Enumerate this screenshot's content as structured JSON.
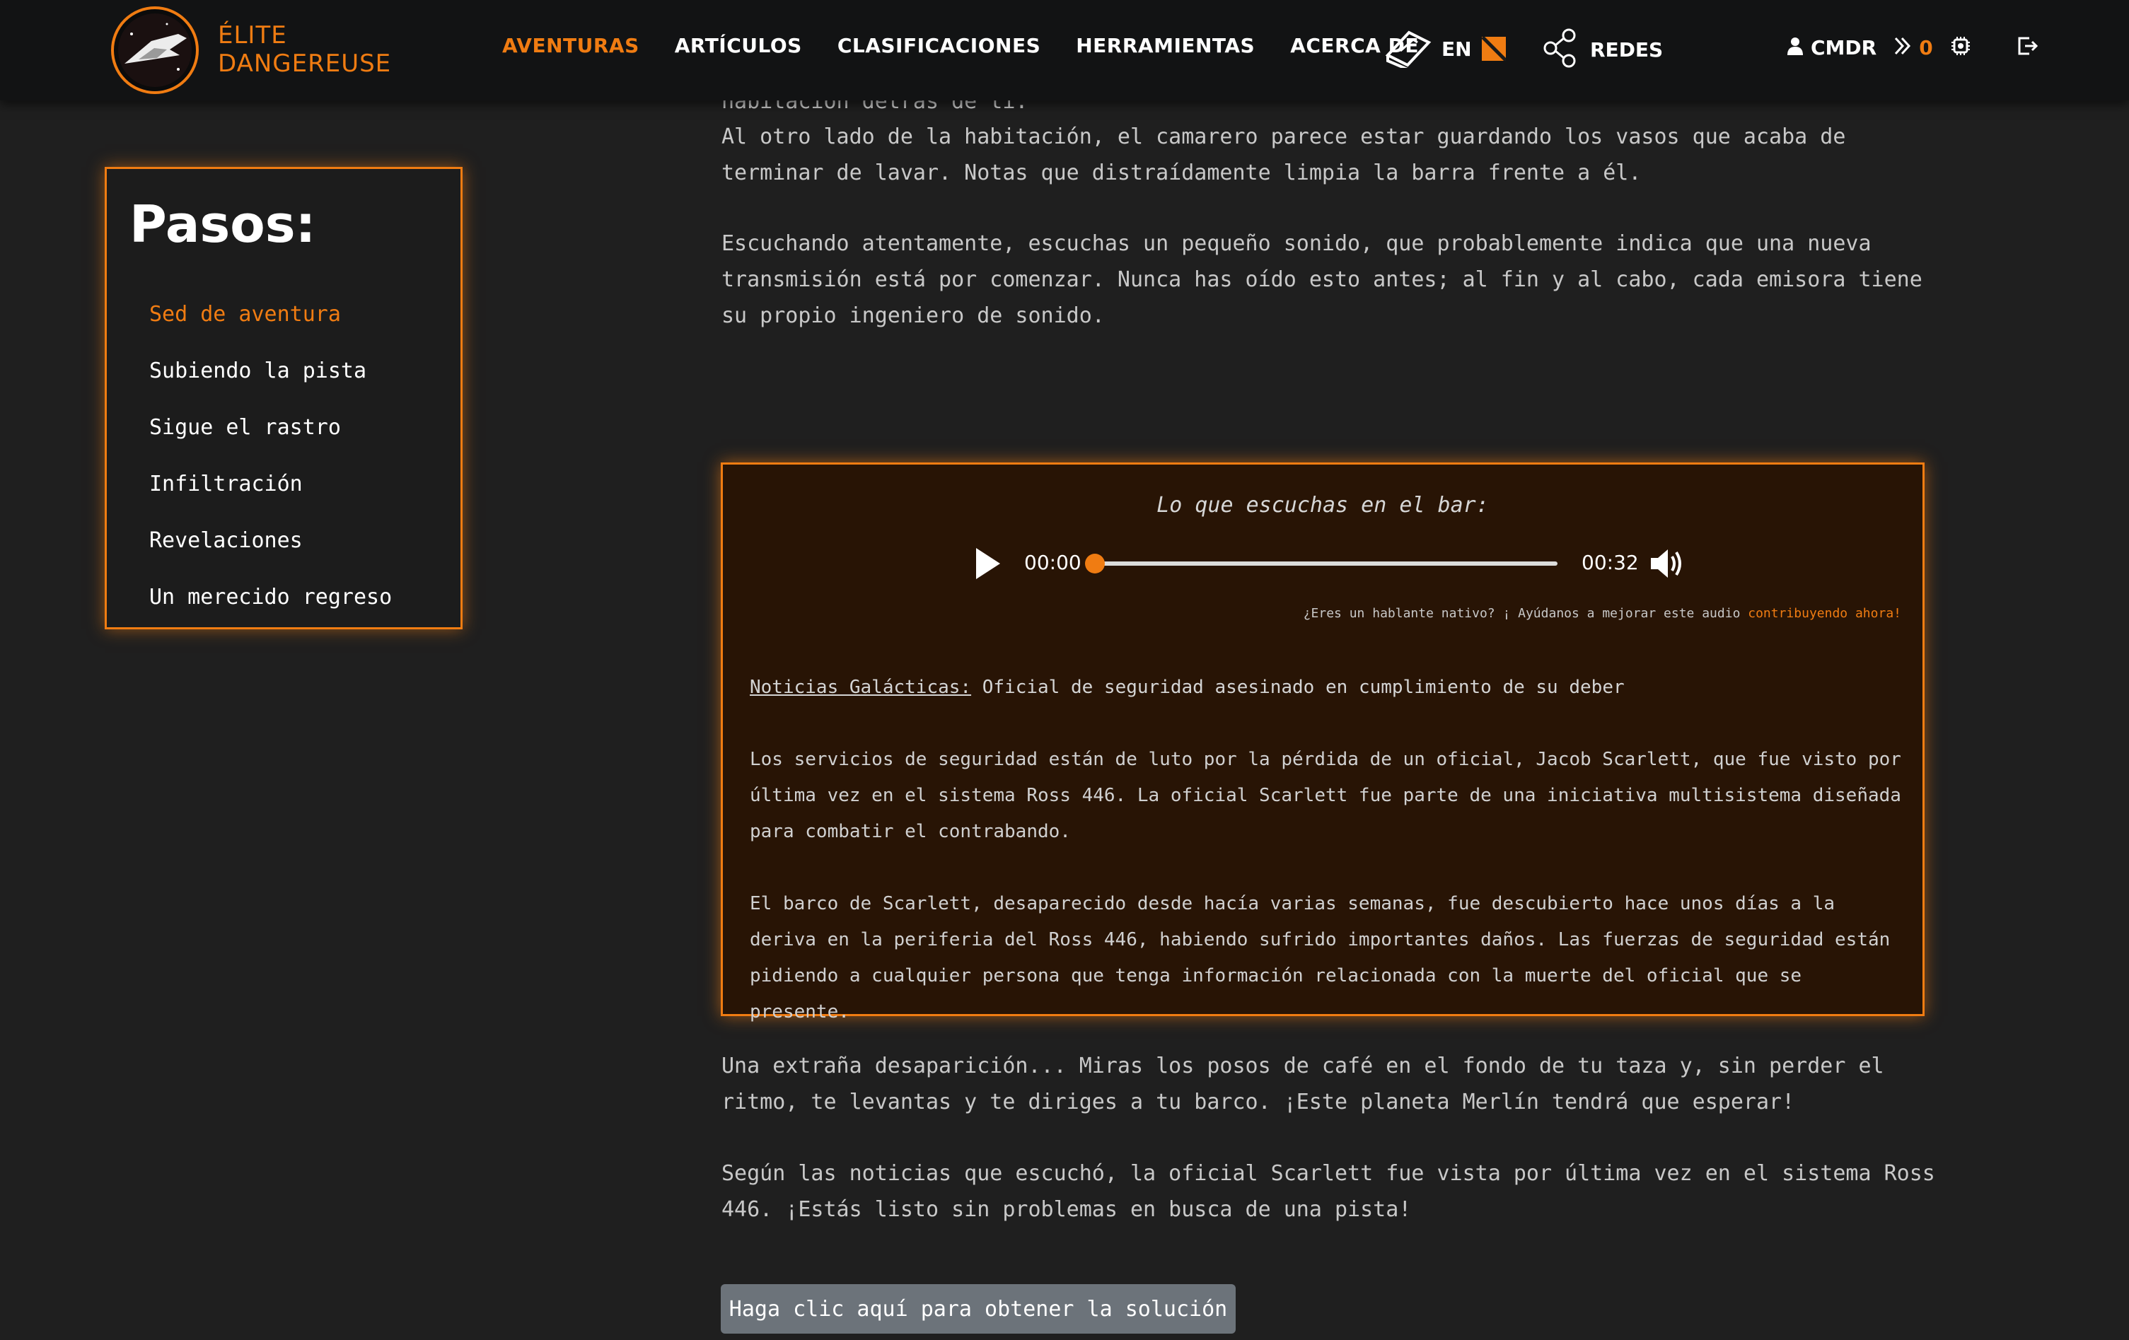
{
  "header": {
    "brand_line1": "ÉLITE",
    "brand_line2": "DANGEREUSE",
    "nav": [
      {
        "label": "AVENTURAS",
        "active": true
      },
      {
        "label": "ARTÍCULOS",
        "active": false
      },
      {
        "label": "CLASIFICACIONES",
        "active": false
      },
      {
        "label": "HERRAMIENTAS",
        "active": false
      },
      {
        "label": "ACERCA DE",
        "active": false
      }
    ],
    "language": "EN",
    "share_label": "REDES",
    "user_label": "CMDR",
    "credits": "0",
    "icons": [
      "logo-ship-icon",
      "book-icon",
      "flag-icon",
      "share-icon",
      "user-icon",
      "chevrons-icon",
      "settings-chip-icon",
      "logout-icon"
    ]
  },
  "sidebar": {
    "title": "Pasos:",
    "steps": [
      {
        "label": "Sed de aventura",
        "active": true
      },
      {
        "label": "Subiendo la pista",
        "active": false
      },
      {
        "label": "Sigue el rastro",
        "active": false
      },
      {
        "label": "Infiltración",
        "active": false
      },
      {
        "label": "Revelaciones",
        "active": false
      },
      {
        "label": "Un merecido regreso",
        "active": false
      }
    ]
  },
  "main": {
    "partial_top": "habitación detrás de ti.",
    "para1": "Al otro lado de la habitación, el camarero parece estar guardando los vasos que acaba de terminar de lavar. Notas que distraídamente limpia la barra frente a él.",
    "para2": "Escuchando atentamente, escuchas un pequeño sonido, que probablemente indica que una nueva transmisión está por comenzar. Nunca has oído esto antes; al fin y al cabo, cada emisora tiene su propio ingeniero de sonido.",
    "audio": {
      "title": "Lo que escuchas en el bar:",
      "current_time": "00:00",
      "duration": "00:32",
      "progress": 0,
      "contrib_text": "¿Eres un hablante nativo? ¡ Ayúdanos a mejorar este audio ",
      "contrib_link": "contribuyendo ahora!",
      "news_label": "Noticias Galácticas:",
      "news_headline": "Oficial de seguridad asesinado en cumplimiento de su deber",
      "news_p1": "Los servicios de seguridad están de luto por la pérdida de un oficial, Jacob Scarlett, que fue visto por última vez en el sistema Ross 446. La oficial Scarlett fue parte de una iniciativa multisistema diseñada para combatir el contrabando.",
      "news_p2": "El barco de Scarlett, desaparecido desde hacía varias semanas, fue descubierto hace unos días a la deriva en la periferia del Ross 446, habiendo sufrido importantes daños. Las fuerzas de seguridad están pidiendo a cualquier persona que tenga información relacionada con la muerte del oficial que se presente."
    },
    "para3": "Una extraña desaparición... Miras los posos de café en el fondo de tu taza y, sin perder el ritmo, te levantas y te diriges a tu barco. ¡Este planeta Merlín tendrá que esperar!",
    "para4": "Según las noticias que escuchó, la oficial Scarlett fue vista por última vez en el sistema Ross 446. ¡Estás listo sin problemas en busca de una pista!",
    "solution_button": "Haga clic aquí para obtener la solución"
  },
  "colors": {
    "accent": "#f07c12",
    "background": "#1f1f1f",
    "header": "#121314",
    "audio_box": "#281405"
  }
}
